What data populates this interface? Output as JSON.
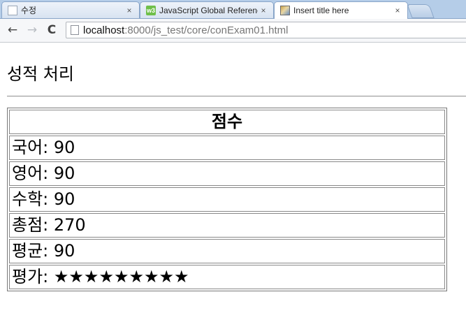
{
  "browser": {
    "tabs": [
      {
        "title": "수정",
        "active": false
      },
      {
        "title": "JavaScript Global Referenc",
        "active": false
      },
      {
        "title": "Insert title here",
        "active": true
      }
    ],
    "close_glyph": "×",
    "nav": {
      "back": "←",
      "forward": "→",
      "reload": "C"
    },
    "url": {
      "host": "localhost",
      "rest": ":8000/js_test/core/conExam01.html"
    }
  },
  "page": {
    "heading": "성적 처리",
    "table": {
      "header": "점수",
      "rows": [
        {
          "label": "국어:",
          "value": "90"
        },
        {
          "label": "영어:",
          "value": "90"
        },
        {
          "label": "수학:",
          "value": "90"
        },
        {
          "label": "총점:",
          "value": "270"
        },
        {
          "label": "평균:",
          "value": "90"
        },
        {
          "label": "평가:",
          "value": "★★★★★★★★★"
        }
      ]
    }
  }
}
